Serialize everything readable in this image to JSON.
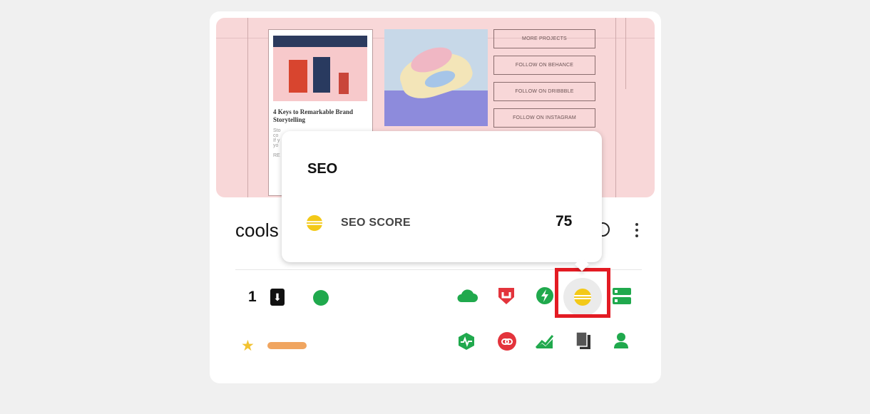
{
  "preview": {
    "post_title": "4 Keys to Remarkable Brand Storytelling",
    "buttons": [
      "MORE PROJECTS",
      "FOLLOW ON BEHANCE",
      "FOLLOW ON DRIBBBLE",
      "FOLLOW ON INSTAGRAM"
    ]
  },
  "card": {
    "site_title": "cools",
    "download_count": "1"
  },
  "tooltip": {
    "heading": "SEO",
    "metric_label": "SEO SCORE",
    "metric_value": "75"
  },
  "icons": {
    "top_row": [
      "cloud-icon",
      "shield-icon",
      "bolt-icon",
      "seo-icon",
      "server-icon"
    ],
    "bottom_row": [
      "activity-icon",
      "link-icon",
      "chart-icon",
      "pages-icon",
      "user-icon"
    ]
  },
  "colors": {
    "green": "#20a94d",
    "red": "#e3343c",
    "yellow": "#f3c918",
    "highlight": "#e31b23",
    "star": "#f2c230",
    "pill": "#f0a560"
  }
}
